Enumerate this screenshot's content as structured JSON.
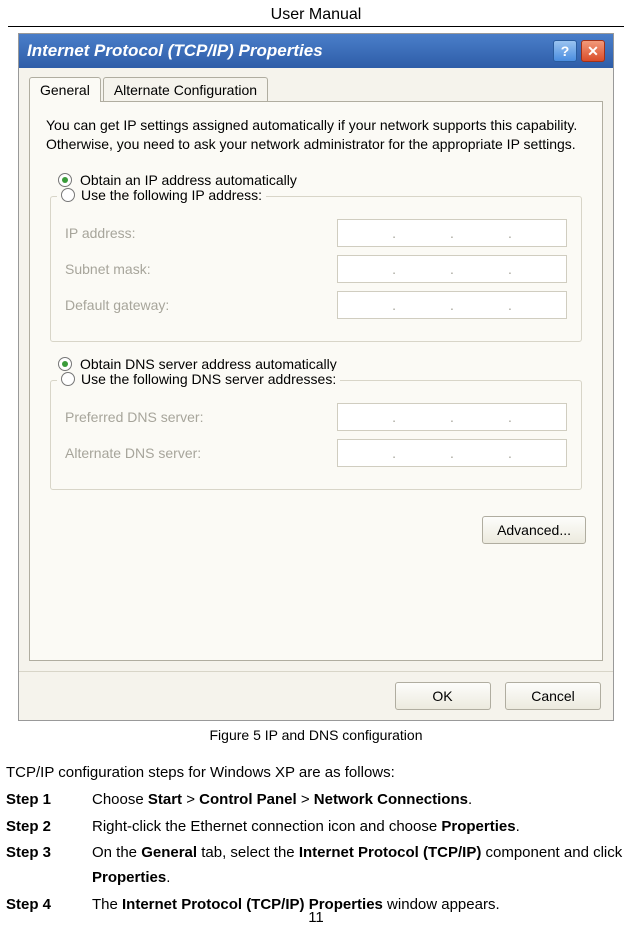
{
  "header": "User Manual",
  "page_number": "11",
  "dialog": {
    "title": "Internet Protocol (TCP/IP) Properties",
    "tabs": {
      "general": "General",
      "alt": "Alternate Configuration"
    },
    "intro": "You can get IP settings assigned automatically if your network supports this capability. Otherwise, you need to ask your network administrator for the appropriate IP settings.",
    "radio_auto_ip": "Obtain an IP address automatically",
    "radio_manual_ip": "Use the following IP address:",
    "ip_address_label": "IP address:",
    "subnet_label": "Subnet mask:",
    "gateway_label": "Default gateway:",
    "radio_auto_dns": "Obtain DNS server address automatically",
    "radio_manual_dns": "Use the following DNS server addresses:",
    "pref_dns_label": "Preferred DNS server:",
    "alt_dns_label": "Alternate DNS server:",
    "advanced_btn": "Advanced...",
    "ok_btn": "OK",
    "cancel_btn": "Cancel"
  },
  "figure_caption": "Figure 5 IP and DNS configuration",
  "body": {
    "intro": "TCP/IP configuration steps for Windows XP are as follows:",
    "steps": [
      {
        "label": "Step 1",
        "parts": [
          "Choose ",
          "Start",
          " > ",
          "Control Panel",
          " > ",
          "Network Connections",
          "."
        ]
      },
      {
        "label": "Step 2",
        "parts": [
          "Right-click the Ethernet connection icon and choose ",
          "Properties",
          "."
        ]
      },
      {
        "label": "Step 3",
        "parts": [
          "On the ",
          "General",
          " tab, select the ",
          "Internet Protocol (TCP/IP)",
          " component and click ",
          "Properties",
          "."
        ]
      },
      {
        "label": "Step 4",
        "parts": [
          "The ",
          "Internet Protocol (TCP/IP) Properties",
          " window appears."
        ]
      }
    ]
  }
}
